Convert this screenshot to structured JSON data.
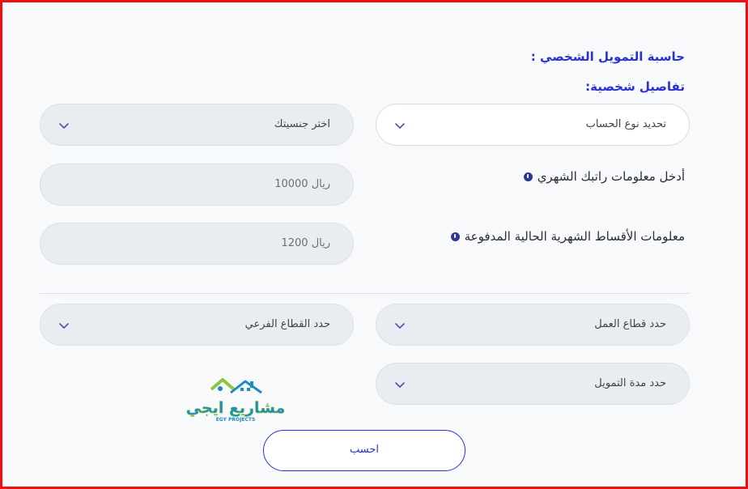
{
  "form": {
    "title": "حاسبة التمويل الشخصي :",
    "section_title": "تفاصيل شخصية:",
    "account_type": {
      "value": "تحديد نوع الحساب"
    },
    "nationality": {
      "value": "اختر جنسيتك"
    },
    "salary": {
      "label": "أدخل معلومات راتبك الشهري",
      "placeholder": "ريال 10000"
    },
    "installments": {
      "label": "معلومات الأقساط الشهرية الحالية المدفوعة",
      "placeholder": "ريال 1200"
    },
    "work_sector": {
      "value": "حدد قطاع العمل"
    },
    "sub_sector": {
      "value": "حدد القطاع الفرعي"
    },
    "finance_period": {
      "value": "حدد مدة التمويل"
    },
    "calculate_label": "احسب"
  },
  "watermark": {
    "text": "مشاريع ايجي",
    "subtext": "EGY PROJECTS"
  },
  "colors": {
    "accent": "#2b2fd6",
    "border": "#ee1111",
    "field_bg": "#e9ecf1",
    "logo_green": "#8cc63f",
    "logo_blue": "#1e8bc3"
  },
  "icons": {
    "dropdown": "chevron-down-icon",
    "info": "info-icon"
  }
}
